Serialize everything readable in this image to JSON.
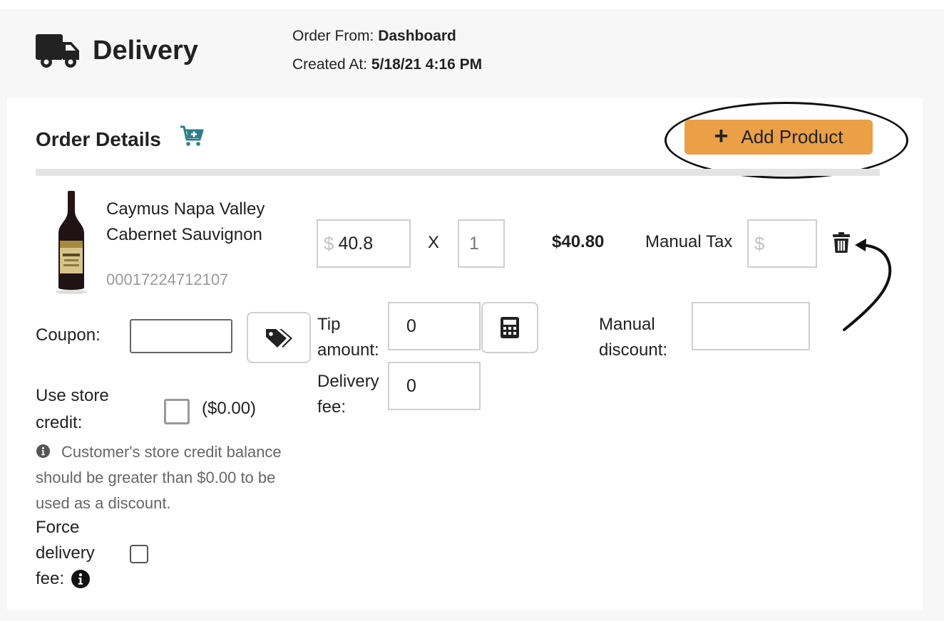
{
  "header": {
    "title": "Delivery",
    "order_from_label": "Order From:",
    "order_from_value": "Dashboard",
    "created_at_label": "Created At:",
    "created_at_value": "5/18/21 4:16 PM",
    "icon": "truck-icon"
  },
  "order_details": {
    "title": "Order Details",
    "cart_icon": "cart-plus-icon",
    "add_product_label": "Add Product",
    "add_product_color": "#eba047"
  },
  "product": {
    "name": "Caymus Napa Valley Cabernet Sauvignon",
    "sku": "00017224712107",
    "price_symbol": "$",
    "price": "40.8",
    "multiply": "X",
    "quantity": "1",
    "total": "$40.80",
    "manual_tax_label": "Manual Tax",
    "manual_tax_symbol": "$",
    "manual_tax_value": ""
  },
  "fields": {
    "coupon_label": "Coupon:",
    "coupon_value": "",
    "tip_label": "Tip amount:",
    "tip_value": "0",
    "manual_discount_label": "Manual discount:",
    "manual_discount_value": "",
    "delivery_fee_label": "Delivery fee:",
    "delivery_fee_value": "0",
    "store_credit_label": "Use store credit:",
    "store_credit_amount": "($0.00)",
    "store_credit_info": "Customer's store credit balance should be greater than $0.00 to be used as a discount.",
    "force_delivery_label_1": "Force",
    "force_delivery_label_2": "delivery",
    "force_delivery_label_3": "fee:"
  }
}
